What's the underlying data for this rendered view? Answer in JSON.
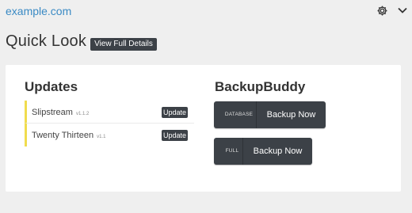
{
  "header": {
    "site_link": "example.com",
    "settings_icon": "gear-icon",
    "collapse_icon": "chevron-down-icon"
  },
  "quick_look": {
    "title": "Quick Look",
    "view_details_label": "View Full Details"
  },
  "updates": {
    "title": "Updates",
    "accent_color": "#f0dc4e",
    "items": [
      {
        "name": "Slipstream",
        "version": "v1.1.2",
        "button": "Update"
      },
      {
        "name": "Twenty Thirteen",
        "version": "v1.1",
        "button": "Update"
      }
    ]
  },
  "backupbuddy": {
    "title": "BackupBuddy",
    "buttons": [
      {
        "type": "DATABASE",
        "action": "Backup Now"
      },
      {
        "type": "FULL",
        "action": "Backup Now"
      }
    ]
  }
}
